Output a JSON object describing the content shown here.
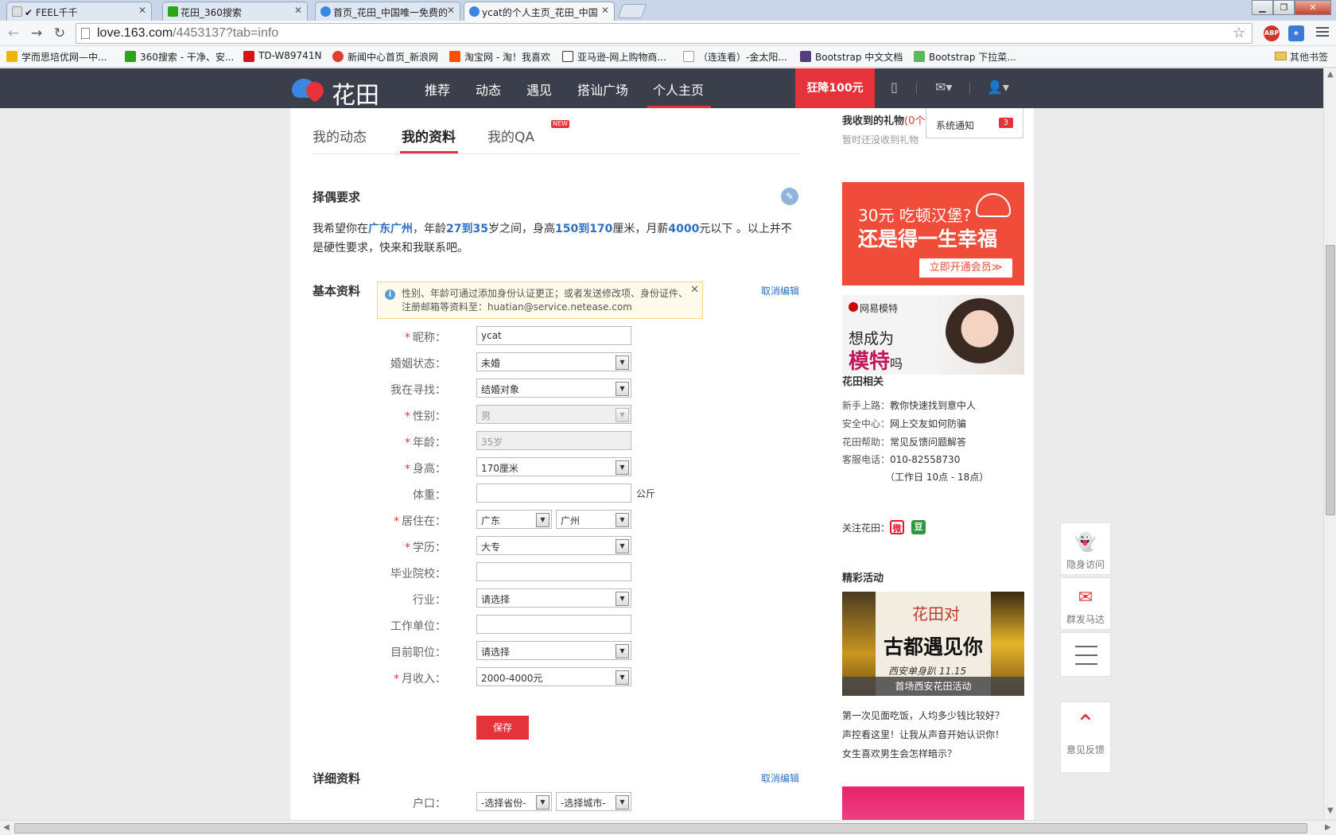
{
  "browser": {
    "tabs": [
      {
        "title": "✔ FEEL千千",
        "color": "#cccccc"
      },
      {
        "title": "花田_360搜索",
        "color": "#2aa515"
      },
      {
        "title": "首页_花田_中国唯一免费的",
        "color": "#3b86e0"
      },
      {
        "title": "ycat的个人主页_花田_中国",
        "color": "#3b86e0"
      }
    ],
    "url_host": "love.163.com",
    "url_path": "/4453137?tab=info",
    "ext_abp": "ABP",
    "bookmarks": [
      {
        "label": "学而思培优网—中...",
        "color": "#f0b400"
      },
      {
        "label": "360搜索 - 干净、安...",
        "color": "#2aa515"
      },
      {
        "label": "TD-W89741N",
        "color": "#d61518"
      },
      {
        "label": "新闻中心首页_新浪网",
        "color": "#e33e2b"
      },
      {
        "label": "淘宝网 - 淘！我喜欢",
        "color": "#ff5000"
      },
      {
        "label": "亚马逊-网上购物商...",
        "color": "#222222"
      },
      {
        "label": "（连连看）-金太阳...",
        "color": "#ffffff"
      },
      {
        "label": "Bootstrap 中文文档",
        "color": "#563d7c"
      },
      {
        "label": "Bootstrap 下拉菜...",
        "color": "#5cb85c"
      }
    ],
    "other_bookmarks": "其他书签"
  },
  "site": {
    "logo_text": "花田",
    "nav": [
      "推荐",
      "动态",
      "遇见",
      "搭讪广场",
      "个人主页"
    ],
    "promo": "狂降100元"
  },
  "subtabs": {
    "items": [
      "我的动态",
      "我的资料",
      "我的QA"
    ],
    "new_badge": "NEW"
  },
  "requirements": {
    "title": "择偶要求",
    "text_1": "我希望你在",
    "location": "广东广州",
    "text_2": "，年龄",
    "age_range": "27到35",
    "text_3": "岁之间，身高",
    "height_range": "150到170",
    "text_4": "厘米，月薪",
    "salary": "4000",
    "text_5": "元以下 。以上并不是硬性要求，快来和我联系吧。"
  },
  "basic": {
    "title": "基本资料",
    "cancel_edit": "取消编辑",
    "notice_line1": "性别、年龄可通过添加身份认证更正；或者发送修改项、身份证件、",
    "notice_line2": "注册邮箱等资料至：huatian@service.netease.com",
    "fields": [
      {
        "label": "昵称：",
        "required": "*",
        "value": "ycat",
        "type": "input"
      },
      {
        "label": "婚姻状态：",
        "required": "",
        "value": "未婚",
        "type": "select"
      },
      {
        "label": "我在寻找：",
        "required": "",
        "value": "结婚对象",
        "type": "select"
      },
      {
        "label": "性别：",
        "required": "*",
        "value": "男",
        "type": "select-disabled"
      },
      {
        "label": "年龄：",
        "required": "*",
        "value": "35岁",
        "type": "input-disabled"
      },
      {
        "label": "身高：",
        "required": "*",
        "value": "170厘米",
        "type": "select"
      },
      {
        "label": "体重：",
        "required": "",
        "value": "",
        "type": "input",
        "unit": "公斤"
      },
      {
        "label": "居住在：",
        "required": "*",
        "value": "广东",
        "value2": "广州",
        "type": "double"
      },
      {
        "label": "学历：",
        "required": "*",
        "value": "大专",
        "type": "select"
      },
      {
        "label": "毕业院校：",
        "required": "",
        "value": "",
        "type": "input"
      },
      {
        "label": "行业：",
        "required": "",
        "value": "请选择",
        "type": "select"
      },
      {
        "label": "工作单位：",
        "required": "",
        "value": "",
        "type": "input"
      },
      {
        "label": "目前职位：",
        "required": "",
        "value": "请选择",
        "type": "select"
      },
      {
        "label": "月收入：",
        "required": "*",
        "value": "2000-4000元",
        "type": "select"
      }
    ],
    "save": "保存"
  },
  "detail": {
    "title": "详细资料",
    "cancel_edit": "取消编辑",
    "hukou_label": "户口：",
    "province_placeholder": "-选择省份-",
    "city_placeholder": "-选择城市-"
  },
  "sidebar": {
    "gifts_title": "我收到的礼物",
    "gifts_count": "(0个",
    "gifts_empty": "暂时还没收到礼物",
    "notification_label": "系统通知",
    "notification_count": "3",
    "ad1_line1": "30元 吃顿汉堡?",
    "ad1_line2": "还是得一生幸福",
    "ad1_button": "立即开通会员≫",
    "ad2_brand": "网易模特",
    "ad2_line1": "想成为",
    "ad2_line2": "模特",
    "ad2_line2_suffix": "吗",
    "related_title": "花田相关",
    "related": [
      {
        "key": "新手上路：",
        "value": "教你快速找到意中人"
      },
      {
        "key": "安全中心：",
        "value": "网上交友如何防骗"
      },
      {
        "key": "花田帮助：",
        "value": "常见反馈问题解答"
      },
      {
        "key": "客服电话：",
        "value": "010-82558730"
      },
      {
        "key": "",
        "value": "（工作日 10点 - 18点）"
      }
    ],
    "follow_label": "关注花田：",
    "follow_icons": [
      {
        "name": "weibo",
        "glyph": "微",
        "color": "#e6162d"
      },
      {
        "name": "douban",
        "glyph": "豆",
        "color": "#2e963d"
      }
    ],
    "events_title": "精彩活动",
    "event_logo": "花田对",
    "event_big": "古都遇见你",
    "event_small": "西安单身趴 11.15",
    "event_caption": "首场西安花田活动",
    "event_links": [
      "第一次见面吃饭，人均多少钱比较好？",
      "声控看这里！让我从声音开始认识你！",
      "女生喜欢男生会怎样暗示？"
    ]
  },
  "float": {
    "stealth": "隐身访问",
    "radar": "群发马达",
    "feedback": "意见反馈"
  }
}
